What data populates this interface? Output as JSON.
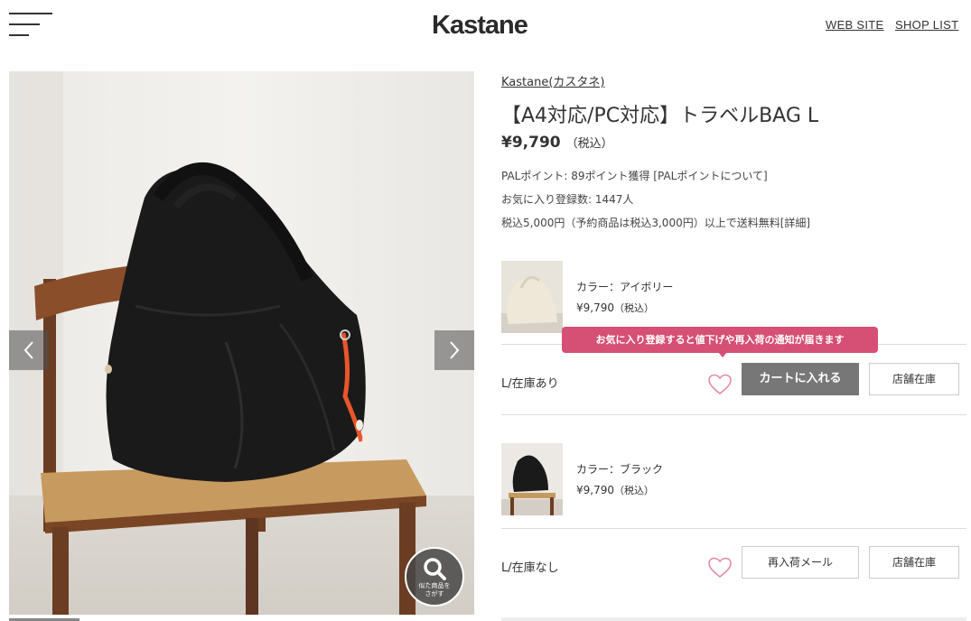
{
  "header": {
    "logo": "Kastane",
    "links": {
      "website": "WEB SITE",
      "shoplist": "SHOP LIST"
    }
  },
  "gallery": {
    "similar_button_label": "似た商品を\nさがす"
  },
  "product": {
    "brand": "Kastane(カスタネ)",
    "title": "【A4対応/PC対応】トラベルBAG L",
    "price": "¥9,790",
    "tax_label": "（税込）",
    "points": "PALポイント: 89ポイント獲得 [PALポイントについて]",
    "favorites": "お気に入り登録数: 1447人",
    "shipping": "税込5,000円（予約商品は税込3,000円）以上で送料無料[詳細]"
  },
  "variants": [
    {
      "color": "カラー：アイボリー",
      "price": "¥9,790",
      "tax": "（税込）",
      "size_stock": "L/在庫あり",
      "primary_button": "カートに入れる",
      "store_button": "店舗在庫"
    },
    {
      "color": "カラー：ブラック",
      "price": "¥9,790",
      "tax": "（税込）",
      "size_stock": "L/在庫なし",
      "primary_button": "再入荷メール",
      "store_button": "店舗在庫"
    }
  ],
  "tooltip": "お気に入り登録すると値下げや再入荷の通知が届きます",
  "colors": {
    "accent_pink": "#d64f75",
    "cart_button": "#777777",
    "heart": "#e48aa8"
  },
  "icons": [
    "hamburger-icon",
    "chevron-left-icon",
    "chevron-right-icon",
    "search-icon",
    "heart-icon"
  ]
}
